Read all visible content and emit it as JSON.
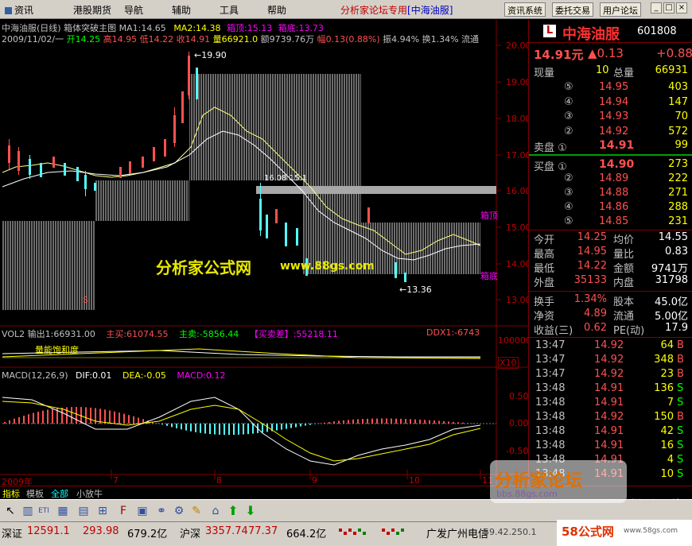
{
  "menu": {
    "items": [
      "资讯",
      "港股期货",
      "导航",
      "辅助",
      "工具",
      "帮助"
    ],
    "forum_title": "分析家论坛专用",
    "stock_bracket": "[中海油服]",
    "buttons": [
      "资讯系统",
      "委托交易",
      "用户论坛"
    ],
    "window_buttons": [
      "_",
      "□",
      "×"
    ]
  },
  "main_chart": {
    "title_line": "中海油服(日线) 箱体突破主图",
    "ma1": "MA1:14.65",
    "ma2": "MA2:14.38",
    "box_top": "箱顶:15.13",
    "box_bottom": "箱底:13.73",
    "date_line": "2009/11/02/一",
    "open": "开14.25",
    "high": "高14.95",
    "low": "低14.22",
    "close": "收14.91",
    "volume": "量66921.0",
    "amount": "额9739.76万",
    "change": "幅0.13(0.88%)",
    "amplitude": "振4.94%",
    "turnover": "换1.34%",
    "circulation": "流通",
    "y_axis": [
      "20.00",
      "19.00",
      "18.00",
      "17.00",
      "16.00",
      "15.00",
      "14.00",
      "13.00"
    ],
    "high_mark": "19.90",
    "low_mark": "13.36",
    "box_top_tag": "箱顶",
    "box_bottom_tag": "箱底",
    "mid_value": "16.08 15.1",
    "sell_tag": "S",
    "watermark": "分析家公式网",
    "watermark_url": "www.88gs.com"
  },
  "vol_panel": {
    "label": "VOL2",
    "output": "输出1:66931.00",
    "main_buy": "主买:61074.55",
    "main_sell": "主卖:-5856.44",
    "diff": "【买卖差】:55218.11",
    "ddx": "DDX1:-6743",
    "note": "量能饱和度",
    "y_axis": [
      "100000",
      "X10"
    ]
  },
  "macd_panel": {
    "label": "MACD(12,26,9)",
    "dif": "DIF:0.01",
    "dea": "DEA:-0.05",
    "macd": "MACD:0.12",
    "y_axis": [
      "0.50",
      "0.00",
      "-0.50"
    ],
    "x_axis": [
      "2009年",
      "7",
      "8",
      "9",
      "10",
      "11"
    ]
  },
  "quote": {
    "logo": "L",
    "name": "中海油服",
    "code": "601808",
    "price": "14.91元",
    "change": "▲0.13",
    "change_pct": "+0.88",
    "current_vol_label": "现量",
    "current_vol": "10",
    "total_vol_label": "总量",
    "total_vol": "66931",
    "sells": [
      {
        "label": "⑤",
        "price": "14.95",
        "vol": "403"
      },
      {
        "label": "④",
        "price": "14.94",
        "vol": "147"
      },
      {
        "label": "③",
        "price": "14.93",
        "vol": "70"
      },
      {
        "label": "②",
        "price": "14.92",
        "vol": "572"
      }
    ],
    "sell1": {
      "label": "卖盘 ①",
      "price": "14.91",
      "vol": "99"
    },
    "buy1": {
      "label": "买盘 ①",
      "price": "14.90",
      "vol": "273"
    },
    "buys": [
      {
        "label": "②",
        "price": "14.89",
        "vol": "222"
      },
      {
        "label": "③",
        "price": "14.88",
        "vol": "271"
      },
      {
        "label": "④",
        "price": "14.86",
        "vol": "288"
      },
      {
        "label": "⑤",
        "price": "14.85",
        "vol": "231"
      }
    ],
    "stats": [
      {
        "l1": "今开",
        "v1": "14.25",
        "l2": "均价",
        "v2": "14.55"
      },
      {
        "l1": "最高",
        "v1": "14.95",
        "l2": "量比",
        "v2": "0.83"
      },
      {
        "l1": "最低",
        "v1": "14.22",
        "l2": "金额",
        "v2": "9741万"
      },
      {
        "l1": "外盘",
        "v1": "35133",
        "l2": "内盘",
        "v2": "31798"
      }
    ],
    "stats2": [
      {
        "l1": "换手",
        "v1": "1.34%",
        "l2": "股本",
        "v2": "45.0亿"
      },
      {
        "l1": "净资",
        "v1": "4.89",
        "l2": "流通",
        "v2": "5.00亿"
      },
      {
        "l1": "收益(三)",
        "v1": "0.62",
        "l2": "PE(动)",
        "v2": "17.9"
      }
    ],
    "ticks": [
      {
        "time": "13:47",
        "price": "14.92",
        "vol": "64",
        "bs": "B"
      },
      {
        "time": "13:47",
        "price": "14.92",
        "vol": "348",
        "bs": "B"
      },
      {
        "time": "13:47",
        "price": "14.92",
        "vol": "23",
        "bs": "B"
      },
      {
        "time": "13:48",
        "price": "14.91",
        "vol": "136",
        "bs": "S"
      },
      {
        "time": "13:48",
        "price": "14.91",
        "vol": "7",
        "bs": "S"
      },
      {
        "time": "13:48",
        "price": "14.92",
        "vol": "150",
        "bs": "B"
      },
      {
        "time": "13:48",
        "price": "14.91",
        "vol": "42",
        "bs": "S"
      },
      {
        "time": "13:48",
        "price": "14.91",
        "vol": "16",
        "bs": "S"
      },
      {
        "time": "13:48",
        "price": "14.91",
        "vol": "4",
        "bs": "S"
      },
      {
        "time": "13:48",
        "price": "14.91",
        "vol": "10",
        "bs": "S"
      }
    ],
    "bottom_tabs": [
      "笔",
      "价",
      "细",
      "量",
      "势",
      "指",
      "值",
      "符"
    ]
  },
  "tabs": [
    "指标",
    "模板",
    "全部",
    "小放牛"
  ],
  "status": {
    "sz_label": "深证",
    "sz_index": "12591.1",
    "sz_change": "293.98",
    "sz_amount": "679.2亿",
    "sh_label": "沪深",
    "sh_index": "3357.74",
    "sh_change": "77.37",
    "sh_amount": "664.2亿",
    "broker": "广发广州电信",
    "ip": "59.42.250.1"
  },
  "watermarks": {
    "forum": "分析家论坛",
    "forum_url": "bbs.88gs.com",
    "site": "58公式网",
    "site_url": "www.58gs.com"
  },
  "colors": {
    "up": "#ff5050",
    "down": "#54fcfc",
    "yellow": "#ffff00",
    "magenta": "#ff00ff",
    "green": "#00ff00",
    "grid": "#800000"
  }
}
